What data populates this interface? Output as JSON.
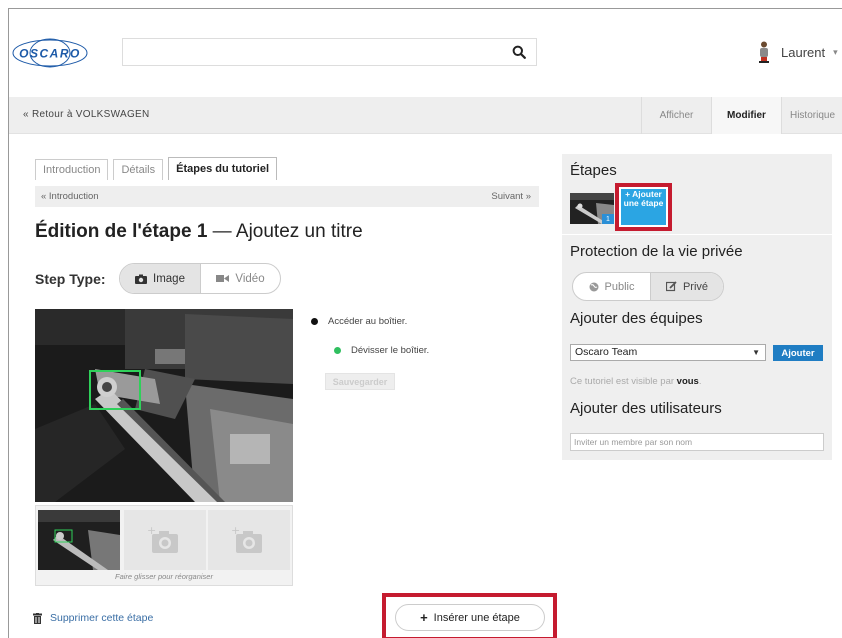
{
  "header": {
    "logo_text": "OSCARO",
    "search": {
      "value": "",
      "placeholder": ""
    },
    "user": {
      "name": "Laurent"
    }
  },
  "subnav": {
    "back_link": "« Retour à VOLKSWAGEN",
    "tabs": [
      {
        "label": "Afficher",
        "active": false
      },
      {
        "label": "Modifier",
        "active": true
      },
      {
        "label": "Historique",
        "active": false
      }
    ]
  },
  "editor": {
    "tabs": [
      {
        "label": "Introduction",
        "active": false
      },
      {
        "label": "Détails",
        "active": false
      },
      {
        "label": "Étapes du tutoriel",
        "active": true
      }
    ],
    "prev_link": "« Introduction",
    "next_link": "Suivant »",
    "title_bold": "Édition de l'étape 1",
    "title_rest": " — Ajoutez un titre",
    "step_type_label": "Step Type:",
    "step_type_options": [
      {
        "label": "Image",
        "selected": true
      },
      {
        "label": "Vidéo",
        "selected": false
      }
    ],
    "bullets": [
      {
        "text": "Accéder au boîtier.",
        "color": "#111111",
        "level": 0
      },
      {
        "text": "Dévisser le boîtier.",
        "color": "#2fbf5f",
        "level": 1
      }
    ],
    "save_label": "Sauvegarder",
    "thumb_caption": "Faire glisser pour réorganiser",
    "delete_label": "Supprimer cette étape",
    "insert_label": "Insérer une étape"
  },
  "sidebar": {
    "steps_title": "Étapes",
    "step_number": "1",
    "add_step_label": "+ Ajouter une étape",
    "privacy_title": "Protection de la vie privée",
    "privacy_options": [
      {
        "label": "Public",
        "selected": false
      },
      {
        "label": "Privé",
        "selected": true
      }
    ],
    "teams_title": "Ajouter des équipes",
    "team_selected": "Oscaro Team",
    "add_team_label": "Ajouter",
    "visible_prefix": "Ce tutoriel est visible par ",
    "visible_bold": "vous",
    "visible_suffix": ".",
    "users_title": "Ajouter des utilisateurs",
    "invite_placeholder": "Inviter un membre par son nom"
  },
  "colors": {
    "highlight_red": "#c51b2f",
    "accent_blue": "#2ba5e3",
    "button_blue": "#1f7dc3",
    "link_blue": "#3a6ea5",
    "logo_blue": "#1d5aa8"
  }
}
